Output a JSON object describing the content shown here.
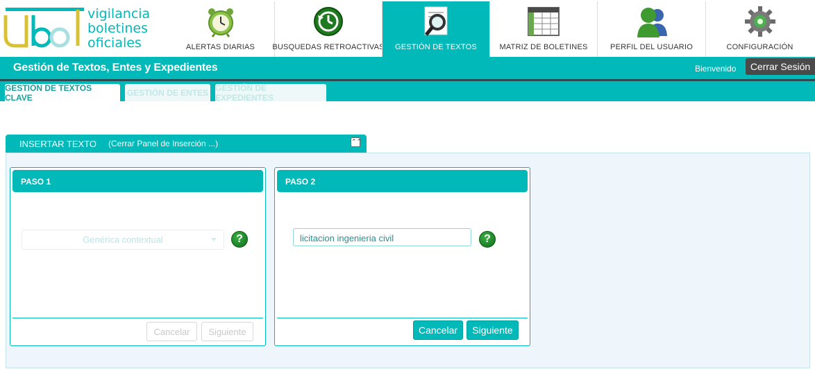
{
  "logo": {
    "mark": "UBO",
    "line1": "vigilancia",
    "line2": "boletines",
    "line3": "oficiales"
  },
  "nav": {
    "items": [
      {
        "label": "ALERTAS DIARIAS",
        "icon": "alarm-clock-icon",
        "active": false
      },
      {
        "label": "BUSQUEDAS RETROACTIVAS",
        "icon": "history-icon",
        "active": false
      },
      {
        "label": "GESTIÓN DE TEXTOS",
        "icon": "document-search-icon",
        "active": true
      },
      {
        "label": "MATRIZ DE BOLETINES",
        "icon": "spreadsheet-icon",
        "active": false
      },
      {
        "label": "PERFIL DEL USUARIO",
        "icon": "users-icon",
        "active": false
      },
      {
        "label": "CONFIGURACIÓN",
        "icon": "gear-icon",
        "active": false
      }
    ]
  },
  "header": {
    "title": "Gestión de Textos, Entes y Expedientes",
    "welcome": "Bienvenido",
    "logout": "Cerrar Sesión"
  },
  "tabs": [
    {
      "label": "GESTIÓN DE TEXTOS CLAVE",
      "active": true
    },
    {
      "label": "GESTIÓN DE ENTES",
      "active": false
    },
    {
      "label": "GESTIÓN DE EXPEDIENTES",
      "active": false
    }
  ],
  "panel": {
    "title": "INSERTAR TEXTO",
    "toggle": "(Cerrar Panel de Inserción ...)",
    "collapse_icon": "double-chevron-up-icon"
  },
  "step1": {
    "title": "PASO 1",
    "select_value": "Genérica contextual",
    "help": "?",
    "cancel": "Cancelar",
    "next": "Siguiente"
  },
  "step2": {
    "title": "PASO 2",
    "input_value": "licitacion ingenieria civil",
    "help": "?",
    "cancel": "Cancelar",
    "next": "Siguiente"
  },
  "colors": {
    "accent": "#00b9b8",
    "dark": "#4a4a4a",
    "panel_bg": "#eef6fb"
  }
}
